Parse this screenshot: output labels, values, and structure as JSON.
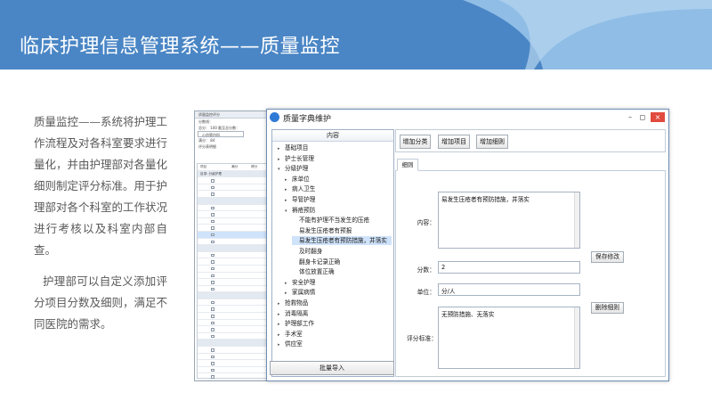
{
  "slide": {
    "title": "临床护理信息管理系统——质量监控",
    "paragraphs": [
      "质量监控——系统将护理工作流程及对各科室要求进行量化，并由护理部对各量化细则制定评分标准。用于护理部对各个科室的工作状况进行考核以及科室内部自查。",
      "护理部可以自定义添加评分项目分数及细则，满足不同医院的需求。"
    ],
    "colors": {
      "banner": "#4a86c5",
      "banner_light": "#8fbde6",
      "text": "#595959"
    }
  },
  "bg_window": {
    "title": "质量监控评分",
    "rows": [
      "分数线：",
      "总分：  100    截至总分数：",
      "心血管内科",
      "满分：   84",
      "评分表明细"
    ],
    "grid_head": [
      "项目",
      "",
      "满分",
      "得分"
    ],
    "section": "目录: 分级护理"
  },
  "dialog": {
    "title": "质量字典维护",
    "window_buttons": {
      "minimize": "–",
      "maximize": "◻",
      "close": "×"
    },
    "tree": {
      "header": "内容",
      "nodes": [
        {
          "label": "基础项目",
          "level": 1,
          "expander": "▸"
        },
        {
          "label": "护士长管理",
          "level": 1,
          "expander": "▸"
        },
        {
          "label": "分级护理",
          "level": 1,
          "expander": "▾"
        },
        {
          "label": "床单位",
          "level": 2,
          "expander": "▸"
        },
        {
          "label": "病人卫生",
          "level": 2,
          "expander": "▸"
        },
        {
          "label": "导管护理",
          "level": 2,
          "expander": "▸"
        },
        {
          "label": "褥疮预防",
          "level": 2,
          "expander": "▾"
        },
        {
          "label": "不能有护理不当发生的压疮",
          "level": 3,
          "expander": ""
        },
        {
          "label": "易发生压疮者有预报",
          "level": 3,
          "expander": ""
        },
        {
          "label": "易发生压疮者有预防措施，并落实",
          "level": 3,
          "expander": "",
          "selected": true
        },
        {
          "label": "及时翻身",
          "level": 3,
          "expander": ""
        },
        {
          "label": "翻身卡记录正确",
          "level": 3,
          "expander": ""
        },
        {
          "label": "体位放置正确",
          "level": 3,
          "expander": ""
        },
        {
          "label": "安全护理",
          "level": 2,
          "expander": "▸"
        },
        {
          "label": "家属病情",
          "level": 2,
          "expander": "▸"
        },
        {
          "label": "抢救物品",
          "level": 1,
          "expander": "▸"
        },
        {
          "label": "消毒隔离",
          "level": 1,
          "expander": "▸"
        },
        {
          "label": "护理部工作",
          "level": 1,
          "expander": "▸"
        },
        {
          "label": "手术室",
          "level": 1,
          "expander": "▸"
        },
        {
          "label": "供应室",
          "level": 1,
          "expander": "▸"
        }
      ],
      "batch_import": "批量导入"
    },
    "toolbar": {
      "add_category": "增加分类",
      "add_item": "增加项目",
      "add_detail": "增加细则"
    },
    "tab": "细则",
    "form": {
      "content_label": "内容：",
      "content_value": "易发生压疮者有预防措施，并落实",
      "save_button": "保存修改",
      "score_label": "分数：",
      "score_value": "2",
      "unit_label": "单位：",
      "unit_value": "分/人",
      "delete_button": "删除细则",
      "criteria_label": "评分标准：",
      "criteria_value": "无预防措施、无落实"
    }
  }
}
